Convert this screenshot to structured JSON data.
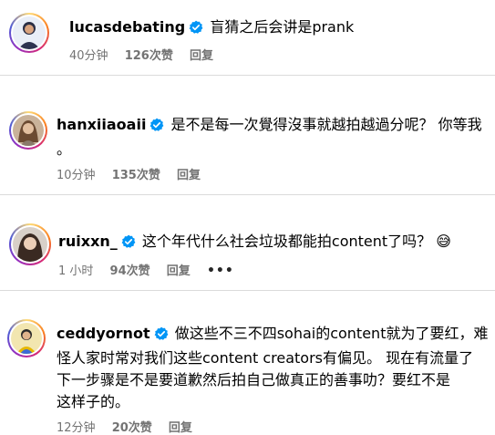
{
  "colors": {
    "verified_blue": "#0095f6",
    "meta_gray": "#737373",
    "divider": "#dbdbdb"
  },
  "icons": {
    "verified": "verified-badge-icon",
    "emoji": "grinning-sweat-emoji",
    "more": "more-options-icon"
  },
  "comments": [
    {
      "username": "lucasdebating",
      "verified": true,
      "lines": [
        "盲猜之后会讲是prank"
      ],
      "time": "40分钟",
      "likes": "126次赞",
      "reply": "回复"
    },
    {
      "username": "hanxiiaoaii",
      "verified": true,
      "lines": [
        "是不是每一次覺得沒事就越拍越過分呢？ 你等我",
        "。"
      ],
      "time": "10分钟",
      "likes": "135次赞",
      "reply": "回复"
    },
    {
      "username": "ruixxn_",
      "verified": true,
      "lines": [
        "这个年代什么社会垃圾都能拍content了吗？"
      ],
      "emoji": "😅",
      "time": "1 小时",
      "likes": "94次赞",
      "reply": "回复",
      "more": "•••"
    },
    {
      "username": "ceddyornot",
      "verified": true,
      "lines": [
        "做这些不三不四sohai的content就为了要红，难",
        "怪人家时常对我们这些content creators有偏见。 现在有流量了",
        "下一步骤是不是要道歉然后拍自己做真正的善事叻？要红不是",
        "这样子的。"
      ],
      "time": "12分钟",
      "likes": "20次赞",
      "reply": "回复"
    }
  ]
}
